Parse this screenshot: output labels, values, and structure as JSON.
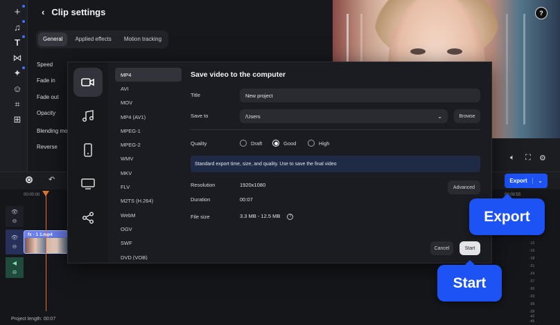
{
  "left_rail": {
    "icons": [
      "plus-icon",
      "music-plus-icon",
      "text-icon",
      "transition-icon",
      "magic-icon",
      "sticker-icon",
      "crop-icon",
      "apps-icon"
    ]
  },
  "clip_settings": {
    "title": "Clip settings",
    "tabs": [
      {
        "label": "General",
        "active": true
      },
      {
        "label": "Applied effects",
        "active": false
      },
      {
        "label": "Motion tracking",
        "active": false
      }
    ],
    "properties": [
      "Speed",
      "Fade in",
      "Fade out",
      "Opacity",
      "Blending mo",
      "Reverse"
    ]
  },
  "timeline": {
    "time_start": "00:00:00",
    "time_end": "00:00:55",
    "clip_label": "fx · 1    1.mp4",
    "project_length": "Project length: 00:07",
    "meter_scale": [
      "-12",
      "-15",
      "-18",
      "-21",
      "-24",
      "-27",
      "-30",
      "-33",
      "-36",
      "-39",
      "-42",
      "-45"
    ]
  },
  "export_button": {
    "label": "Export"
  },
  "dialog": {
    "title": "Save video to the computer",
    "categories": [
      {
        "icon": "video-icon",
        "active": true
      },
      {
        "icon": "audio-icon",
        "active": false
      },
      {
        "icon": "mobile-icon",
        "active": false
      },
      {
        "icon": "tv-icon",
        "active": false
      },
      {
        "icon": "share-icon",
        "active": false
      }
    ],
    "formats": [
      "MP4",
      "AVI",
      "MOV",
      "MP4 (AV1)",
      "MPEG-1",
      "MPEG-2",
      "WMV",
      "MKV",
      "FLV",
      "M2TS (H.264)",
      "WebM",
      "OGV",
      "SWF",
      "DVD (VOB)"
    ],
    "selected_format": "MP4",
    "title_label": "Title",
    "title_value": "New project",
    "save_to_label": "Save to",
    "save_to_value": "/Users",
    "browse_label": "Browse",
    "quality_label": "Quality",
    "quality_options": [
      "Draft",
      "Good",
      "High"
    ],
    "quality_selected": "Good",
    "quality_info": "Standard export time, size, and quality. Use to save the final video",
    "resolution_label": "Resolution",
    "resolution_value": "1920x1080",
    "advanced_label": "Advanced",
    "duration_label": "Duration",
    "duration_value": "00:07",
    "filesize_label": "File size",
    "filesize_value": "3.3 MB - 12.5 MB",
    "cancel_label": "Cancel",
    "start_label": "Start"
  },
  "callouts": {
    "export": "Export",
    "start": "Start"
  }
}
